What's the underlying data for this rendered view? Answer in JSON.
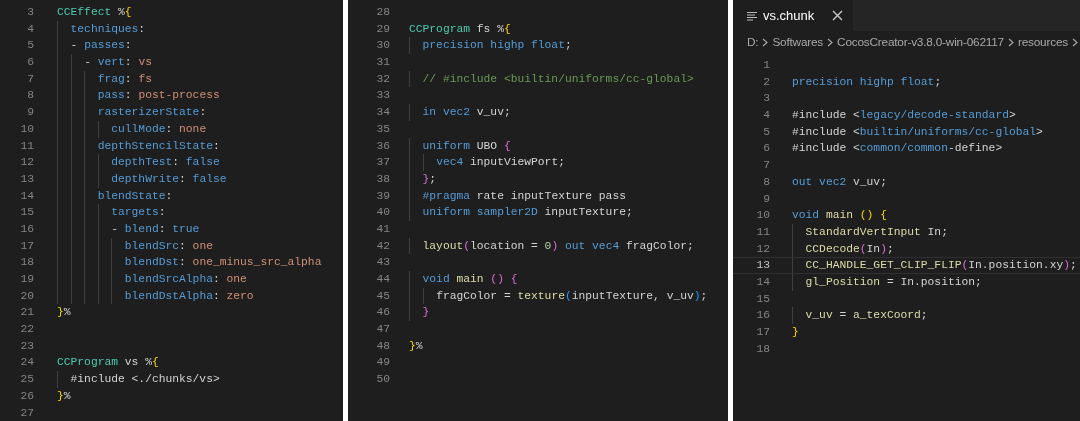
{
  "panels": [
    {
      "lines": [
        {
          "number": "3",
          "tokens": [
            {
              "text": "CCEffect",
              "kind": "tag"
            },
            {
              "text": " %",
              "kind": "plain"
            },
            {
              "text": "{",
              "kind": "bracket1"
            }
          ]
        },
        {
          "number": "4",
          "tokens": [
            {
              "text": "  techniques",
              "kind": "key"
            },
            {
              "text": ":",
              "kind": "plain"
            }
          ]
        },
        {
          "number": "5",
          "tokens": [
            {
              "text": "  - ",
              "kind": "plain"
            },
            {
              "text": "passes",
              "kind": "key"
            },
            {
              "text": ":",
              "kind": "plain"
            }
          ]
        },
        {
          "number": "6",
          "tokens": [
            {
              "text": "    - ",
              "kind": "plain"
            },
            {
              "text": "vert",
              "kind": "key"
            },
            {
              "text": ": ",
              "kind": "plain"
            },
            {
              "text": "vs",
              "kind": "value"
            }
          ]
        },
        {
          "number": "7",
          "tokens": [
            {
              "text": "      frag",
              "kind": "key"
            },
            {
              "text": ": ",
              "kind": "plain"
            },
            {
              "text": "fs",
              "kind": "value"
            }
          ]
        },
        {
          "number": "8",
          "tokens": [
            {
              "text": "      pass",
              "kind": "key"
            },
            {
              "text": ": ",
              "kind": "plain"
            },
            {
              "text": "post-process",
              "kind": "value"
            }
          ]
        },
        {
          "number": "9",
          "tokens": [
            {
              "text": "      rasterizerState",
              "kind": "key"
            },
            {
              "text": ":",
              "kind": "plain"
            }
          ]
        },
        {
          "number": "10",
          "tokens": [
            {
              "text": "        cullMode",
              "kind": "key"
            },
            {
              "text": ": ",
              "kind": "plain"
            },
            {
              "text": "none",
              "kind": "value"
            }
          ]
        },
        {
          "number": "11",
          "tokens": [
            {
              "text": "      depthStencilState",
              "kind": "key"
            },
            {
              "text": ":",
              "kind": "plain"
            }
          ]
        },
        {
          "number": "12",
          "tokens": [
            {
              "text": "        depthTest",
              "kind": "key"
            },
            {
              "text": ": ",
              "kind": "plain"
            },
            {
              "text": "false",
              "kind": "keyword"
            }
          ]
        },
        {
          "number": "13",
          "tokens": [
            {
              "text": "        depthWrite",
              "kind": "key"
            },
            {
              "text": ": ",
              "kind": "plain"
            },
            {
              "text": "false",
              "kind": "keyword"
            }
          ]
        },
        {
          "number": "14",
          "tokens": [
            {
              "text": "      blendState",
              "kind": "key"
            },
            {
              "text": ":",
              "kind": "plain"
            }
          ]
        },
        {
          "number": "15",
          "tokens": [
            {
              "text": "        targets",
              "kind": "key"
            },
            {
              "text": ":",
              "kind": "plain"
            }
          ]
        },
        {
          "number": "16",
          "tokens": [
            {
              "text": "        - ",
              "kind": "plain"
            },
            {
              "text": "blend",
              "kind": "key"
            },
            {
              "text": ": ",
              "kind": "plain"
            },
            {
              "text": "true",
              "kind": "keyword"
            }
          ]
        },
        {
          "number": "17",
          "tokens": [
            {
              "text": "          blendSrc",
              "kind": "key"
            },
            {
              "text": ": ",
              "kind": "plain"
            },
            {
              "text": "one",
              "kind": "value"
            }
          ]
        },
        {
          "number": "18",
          "tokens": [
            {
              "text": "          blendDst",
              "kind": "key"
            },
            {
              "text": ": ",
              "kind": "plain"
            },
            {
              "text": "one_minus_src_alpha",
              "kind": "value"
            }
          ]
        },
        {
          "number": "19",
          "tokens": [
            {
              "text": "          blendSrcAlpha",
              "kind": "key"
            },
            {
              "text": ": ",
              "kind": "plain"
            },
            {
              "text": "one",
              "kind": "value"
            }
          ]
        },
        {
          "number": "20",
          "tokens": [
            {
              "text": "          blendDstAlpha",
              "kind": "key"
            },
            {
              "text": ": ",
              "kind": "plain"
            },
            {
              "text": "zero",
              "kind": "value"
            }
          ]
        },
        {
          "number": "21",
          "tokens": [
            {
              "text": "}",
              "kind": "bracket1"
            },
            {
              "text": "%",
              "kind": "plain"
            }
          ]
        },
        {
          "number": "22"
        },
        {
          "number": "23"
        },
        {
          "number": "24",
          "tokens": [
            {
              "text": "CCProgram",
              "kind": "tag"
            },
            {
              "text": " vs %",
              "kind": "plain"
            },
            {
              "text": "{",
              "kind": "bracket1"
            }
          ]
        },
        {
          "number": "25",
          "tokens": [
            {
              "text": "  #include <./chunks/vs>",
              "kind": "plain"
            }
          ]
        },
        {
          "number": "26",
          "tokens": [
            {
              "text": "}",
              "kind": "bracket1"
            },
            {
              "text": "%",
              "kind": "plain"
            }
          ]
        },
        {
          "number": "27"
        }
      ]
    },
    {
      "lines": [
        {
          "number": "28"
        },
        {
          "number": "29",
          "tokens": [
            {
              "text": "CCProgram",
              "kind": "tag"
            },
            {
              "text": " fs %",
              "kind": "plain"
            },
            {
              "text": "{",
              "kind": "bracket1"
            }
          ]
        },
        {
          "number": "30",
          "tokens": [
            {
              "text": "  precision highp float",
              "kind": "keyword"
            },
            {
              "text": ";",
              "kind": "plain"
            }
          ]
        },
        {
          "number": "31"
        },
        {
          "number": "32",
          "tokens": [
            {
              "text": "  // #include <builtin/uniforms/cc-global>",
              "kind": "comment"
            }
          ]
        },
        {
          "number": "33"
        },
        {
          "number": "34",
          "tokens": [
            {
              "text": "  in vec2",
              "kind": "keyword"
            },
            {
              "text": " v_uv;",
              "kind": "plain"
            }
          ]
        },
        {
          "number": "35"
        },
        {
          "number": "36",
          "tokens": [
            {
              "text": "  uniform",
              "kind": "keyword"
            },
            {
              "text": " UBO ",
              "kind": "plain"
            },
            {
              "text": "{",
              "kind": "bracket2"
            }
          ]
        },
        {
          "number": "37",
          "tokens": [
            {
              "text": "    vec4",
              "kind": "keyword"
            },
            {
              "text": " inputViewPort;",
              "kind": "plain"
            }
          ]
        },
        {
          "number": "38",
          "tokens": [
            {
              "text": "  }",
              "kind": "bracket2"
            },
            {
              "text": ";",
              "kind": "plain"
            }
          ]
        },
        {
          "number": "39",
          "tokens": [
            {
              "text": "  #pragma",
              "kind": "keyword"
            },
            {
              "text": " rate inputTexture pass",
              "kind": "plain"
            }
          ]
        },
        {
          "number": "40",
          "tokens": [
            {
              "text": "  uniform sampler2D",
              "kind": "keyword"
            },
            {
              "text": " inputTexture;",
              "kind": "plain"
            }
          ]
        },
        {
          "number": "41"
        },
        {
          "number": "42",
          "tokens": [
            {
              "text": "  layout",
              "kind": "function"
            },
            {
              "text": "(",
              "kind": "bracket2"
            },
            {
              "text": "location = ",
              "kind": "plain"
            },
            {
              "text": "0",
              "kind": "number"
            },
            {
              "text": ")",
              "kind": "bracket2"
            },
            {
              "text": " out vec4",
              "kind": "keyword"
            },
            {
              "text": " fragColor;",
              "kind": "plain"
            }
          ]
        },
        {
          "number": "43"
        },
        {
          "number": "44",
          "tokens": [
            {
              "text": "  void",
              "kind": "keyword"
            },
            {
              "text": " main",
              "kind": "function"
            },
            {
              "text": " ()",
              "kind": "bracket2"
            },
            {
              "text": " {",
              "kind": "bracket2"
            }
          ]
        },
        {
          "number": "45",
          "tokens": [
            {
              "text": "    fragColor = ",
              "kind": "plain"
            },
            {
              "text": "texture",
              "kind": "function"
            },
            {
              "text": "(",
              "kind": "bracket3"
            },
            {
              "text": "inputTexture, v_uv",
              "kind": "plain"
            },
            {
              "text": ")",
              "kind": "bracket3"
            },
            {
              "text": ";",
              "kind": "plain"
            }
          ]
        },
        {
          "number": "46",
          "tokens": [
            {
              "text": "  }",
              "kind": "bracket2"
            }
          ]
        },
        {
          "number": "47"
        },
        {
          "number": "48",
          "tokens": [
            {
              "text": "}",
              "kind": "bracket1"
            },
            {
              "text": "%",
              "kind": "plain"
            }
          ]
        },
        {
          "number": "49"
        },
        {
          "number": "50"
        }
      ]
    },
    {
      "tab": {
        "label": "vs.chunk",
        "selected": true
      },
      "breadcrumb": [
        "D:",
        "Softwares",
        "CocosCreator-v3.8.0-win-062117",
        "resources"
      ],
      "lines": [
        {
          "number": "1"
        },
        {
          "number": "2",
          "tokens": [
            {
              "text": "precision highp float",
              "kind": "keyword"
            },
            {
              "text": ";",
              "kind": "plain"
            }
          ]
        },
        {
          "number": "3"
        },
        {
          "number": "4",
          "tokens": [
            {
              "text": "#include <",
              "kind": "plain"
            },
            {
              "text": "legacy/decode-standard",
              "kind": "keyword"
            },
            {
              "text": ">",
              "kind": "plain"
            }
          ]
        },
        {
          "number": "5",
          "tokens": [
            {
              "text": "#include <",
              "kind": "plain"
            },
            {
              "text": "builtin/uniforms/cc-global",
              "kind": "keyword"
            },
            {
              "text": ">",
              "kind": "plain"
            }
          ]
        },
        {
          "number": "6",
          "tokens": [
            {
              "text": "#include <",
              "kind": "plain"
            },
            {
              "text": "common/common",
              "kind": "keyword"
            },
            {
              "text": "-define>",
              "kind": "plain"
            }
          ]
        },
        {
          "number": "7"
        },
        {
          "number": "8",
          "tokens": [
            {
              "text": "out vec2",
              "kind": "keyword"
            },
            {
              "text": " v_uv;",
              "kind": "plain"
            }
          ]
        },
        {
          "number": "9"
        },
        {
          "number": "10",
          "tokens": [
            {
              "text": "void",
              "kind": "keyword"
            },
            {
              "text": " main",
              "kind": "function"
            },
            {
              "text": " ()",
              "kind": "bracket1"
            },
            {
              "text": " {",
              "kind": "bracket1"
            }
          ]
        },
        {
          "number": "11",
          "tokens": [
            {
              "text": "  StandardVertInput",
              "kind": "function"
            },
            {
              "text": " In;",
              "kind": "plain"
            }
          ]
        },
        {
          "number": "12",
          "tokens": [
            {
              "text": "  CCDecode",
              "kind": "function"
            },
            {
              "text": "(",
              "kind": "bracket2"
            },
            {
              "text": "In",
              "kind": "plain"
            },
            {
              "text": ")",
              "kind": "bracket2"
            },
            {
              "text": ";",
              "kind": "plain"
            }
          ]
        },
        {
          "number": "13",
          "current": true,
          "tokens": [
            {
              "text": "  CC_HANDLE_GET_CLIP_FLIP",
              "kind": "function"
            },
            {
              "text": "(",
              "kind": "bracket2"
            },
            {
              "text": "In.position.xy",
              "kind": "plain"
            },
            {
              "text": ")",
              "kind": "bracket2"
            },
            {
              "text": ";",
              "kind": "plain"
            }
          ]
        },
        {
          "number": "14",
          "tokens": [
            {
              "text": "  gl_Position",
              "kind": "function"
            },
            {
              "text": " = In.position;",
              "kind": "plain"
            }
          ]
        },
        {
          "number": "15"
        },
        {
          "number": "16",
          "tokens": [
            {
              "text": "  v_uv",
              "kind": "function"
            },
            {
              "text": " = ",
              "kind": "plain"
            },
            {
              "text": "a_texCoord",
              "kind": "function"
            },
            {
              "text": ";",
              "kind": "plain"
            }
          ]
        },
        {
          "number": "17",
          "tokens": [
            {
              "text": "}",
              "kind": "bracket1"
            }
          ]
        },
        {
          "number": "18"
        }
      ]
    }
  ]
}
